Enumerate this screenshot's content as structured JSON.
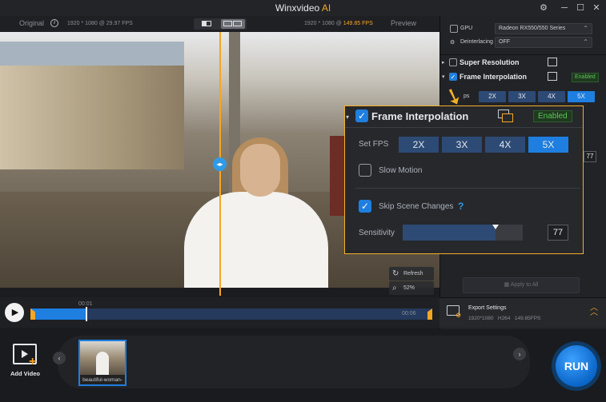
{
  "app": {
    "title_main": "Winxvideo",
    "title_ai": "AI"
  },
  "preview_header": {
    "original_label": "Original",
    "original_info": "1920 * 1080 @ 29.97 FPS",
    "preview_info_res": "1920 * 1080 @",
    "preview_info_fps": "149.85 FPS",
    "preview_label": "Preview"
  },
  "video_controls": {
    "refresh_label": "Refresh",
    "zoom_level": "52%"
  },
  "timeline": {
    "start_time": "00:01",
    "end_time": "00:06",
    "progress": 0.14
  },
  "right_panel": {
    "gpu_label": "GPU",
    "gpu_value": "Radeon RX550/550 Series",
    "deinterlacing_label": "Deinterlacing",
    "deinterlacing_value": "OFF",
    "super_resolution_label": "Super Resolution",
    "frame_interpolation_label": "Frame Interpolation",
    "frame_interpolation_status": "Enabled",
    "set_fps_partial": "ps",
    "fps_options": [
      "2X",
      "3X",
      "4X",
      "5X"
    ],
    "fps_selected": "5X",
    "sensitivity_partial": "77",
    "apply_to_all": "Apply to All",
    "export_title": "Export Settings",
    "export_res": "1920*1080",
    "export_codec": "H264",
    "export_fps": "149.85FPS"
  },
  "zoom_panel": {
    "title": "Frame Interpolation",
    "status": "Enabled",
    "set_fps_label": "Set FPS",
    "fps_options": [
      "2X",
      "3X",
      "4X",
      "5X"
    ],
    "fps_selected": "5X",
    "slow_motion_label": "Slow Motion",
    "slow_motion_checked": false,
    "skip_scene_label": "Skip Scene Changes",
    "skip_scene_checked": true,
    "help_symbol": "?",
    "sensitivity_label": "Sensitivity",
    "sensitivity_value": "77",
    "sensitivity_level": 0.77
  },
  "bottom": {
    "add_video_label": "Add Video",
    "thumb_label": "beautiful-woman-",
    "run_label": "RUN"
  },
  "colors": {
    "accent_orange": "#f5a623",
    "accent_blue": "#1e7fe0",
    "enabled_green": "#5ec45c"
  }
}
